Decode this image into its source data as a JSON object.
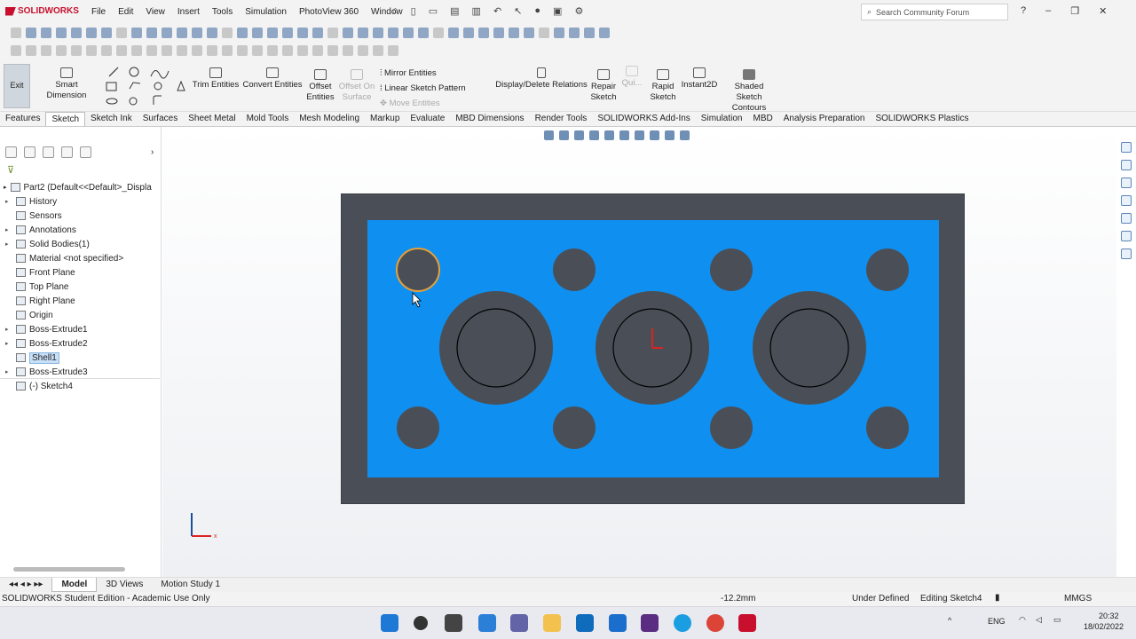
{
  "app": {
    "logo": "SOLIDWORKS",
    "menu": [
      "File",
      "Edit",
      "View",
      "Insert",
      "Tools",
      "Simulation",
      "PhotoView 360",
      "Window"
    ],
    "search_placeholder": "Search Community Forum"
  },
  "ribbon": {
    "exit": "Exit",
    "smart_dimension": "Smart Dimension",
    "trim": "Trim Entities",
    "convert": "Convert Entities",
    "offset": "Offset Entities",
    "offset_surface": "Offset On Surface",
    "mirror": "Mirror Entities",
    "linear_pattern": "Linear Sketch Pattern",
    "move": "Move Entities",
    "display_relations": "Display/Delete Relations",
    "repair": "Repair Sketch",
    "quick": "Qui...",
    "rapid": "Rapid Sketch",
    "instant2d": "Instant2D",
    "shaded": "Shaded Sketch Contours"
  },
  "tabs": [
    "Features",
    "Sketch",
    "Sketch Ink",
    "Surfaces",
    "Sheet Metal",
    "Mold Tools",
    "Mesh Modeling",
    "Markup",
    "Evaluate",
    "MBD Dimensions",
    "Render Tools",
    "SOLIDWORKS Add-Ins",
    "Simulation",
    "MBD",
    "Analysis Preparation",
    "SOLIDWORKS Plastics"
  ],
  "active_tab": "Sketch",
  "tree": {
    "root": "Part2  (Default<<Default>_Displa",
    "items": [
      {
        "label": "History",
        "arrow": true
      },
      {
        "label": "Sensors",
        "arrow": false
      },
      {
        "label": "Annotations",
        "arrow": true
      },
      {
        "label": "Solid Bodies(1)",
        "arrow": true
      },
      {
        "label": "Material <not specified>",
        "arrow": false
      },
      {
        "label": "Front Plane",
        "arrow": false
      },
      {
        "label": "Top Plane",
        "arrow": false
      },
      {
        "label": "Right Plane",
        "arrow": false
      },
      {
        "label": "Origin",
        "arrow": false
      },
      {
        "label": "Boss-Extrude1",
        "arrow": true
      },
      {
        "label": "Boss-Extrude2",
        "arrow": true
      },
      {
        "label": "Shell1",
        "arrow": false,
        "selected": true
      },
      {
        "label": "Boss-Extrude3",
        "arrow": true
      },
      {
        "label": "(-) Sketch4",
        "arrow": false
      }
    ]
  },
  "bottom_tabs": [
    "Model",
    "3D Views",
    "Motion Study 1"
  ],
  "status": {
    "edition": "SOLIDWORKS Student Edition - Academic Use Only",
    "coord": "-12.2mm",
    "state": "Under Defined",
    "editing": "Editing Sketch4",
    "units": "MMGS"
  },
  "taskbar": {
    "lang": "ENG",
    "time": "20:32",
    "date": "18/02/2022"
  },
  "colors": {
    "face": "#0f8fef",
    "body": "#4a4f57",
    "highlight": "#e8a038"
  }
}
